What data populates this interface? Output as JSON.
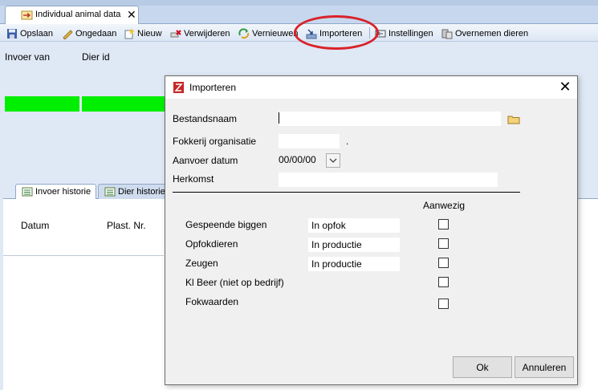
{
  "document_tab": {
    "title": "Individual animal data",
    "close": "✕"
  },
  "toolbar": {
    "save": "Opslaan",
    "undo": "Ongedaan",
    "new": "Nieuw",
    "delete": "Verwijderen",
    "refresh": "Vernieuwen",
    "import": "Importeren",
    "settings": "Instellingen",
    "transfer": "Overnemen dieren"
  },
  "form": {
    "invoer_van": "Invoer van",
    "dier_id": "Dier id"
  },
  "sub_tabs": {
    "invoer_historie": "Invoer historie",
    "dier_historie": "Dier historie"
  },
  "grid": {
    "columns": [
      "Datum",
      "Plast. Nr."
    ]
  },
  "dialog": {
    "title": "Importeren",
    "close": "✕",
    "fields": {
      "bestandsnaam": {
        "label": "Bestandsnaam",
        "value": ""
      },
      "fokkerij": {
        "label": "Fokkerij organisatie",
        "value": "",
        "suffix": "."
      },
      "aanvoer_datum": {
        "label": "Aanvoer datum",
        "value": "00/00/00"
      },
      "herkomst": {
        "label": "Herkomst",
        "value": ""
      }
    },
    "aanwezig_header": "Aanwezig",
    "rows": [
      {
        "label": "Gespeende biggen",
        "status": "In opfok",
        "checked": false
      },
      {
        "label": "Opfokdieren",
        "status": "In productie",
        "checked": false
      },
      {
        "label": "Zeugen",
        "status": "In productie",
        "checked": false
      },
      {
        "label": "Kl Beer (niet op bedrijf)",
        "status": "",
        "checked": false
      },
      {
        "label": "Fokwaarden",
        "status": "",
        "checked": false
      }
    ],
    "ok": "Ok",
    "cancel": "Annuleren"
  },
  "colors": {
    "highlight": "#d9232a",
    "status_green": "#00ee00",
    "toolbar_bg": "#dbe6f4"
  }
}
